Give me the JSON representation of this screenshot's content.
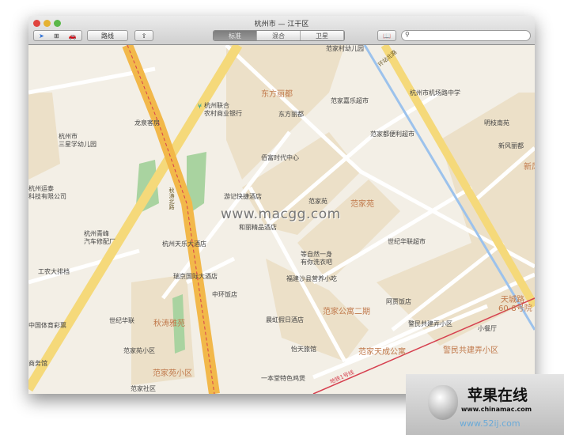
{
  "window": {
    "title": "杭州市 — 江干区"
  },
  "toolbar": {
    "directions_label": "路线",
    "map_types": [
      "标准",
      "混合",
      "卫星"
    ],
    "selected_map_type": "标准",
    "search_placeholder": ""
  },
  "map": {
    "watermark": "www.macgg.com",
    "districts": [
      "东方丽都",
      "范家苑",
      "秋涛雅苑",
      "范家苑小区",
      "范家公寓二期",
      "范家天成公寓",
      "警民共建弄小区",
      "天城路",
      "60-8号院",
      "新风"
    ],
    "pois": [
      "范家村幼儿园",
      "范家嘉乐超市",
      "杭州市机场路中学",
      "东方丽都",
      "范家都便利超市",
      "明枝南苑",
      "新风丽都",
      "佰富时代中心",
      "杭州联合",
      "农村商业银行",
      "龙泉客房",
      "杭州市",
      "三星学幼儿园",
      "杭州运泰",
      "科技有限公司",
      "游记快捷酒店",
      "范家苑",
      "和丽精品酒店",
      "杭州青峰",
      "汽车修配厂",
      "杭州天乐大酒店",
      "工农大排档",
      "瑞京国际大酒店",
      "中环饭店",
      "世纪华联",
      "中国体育彩票",
      "范家苑小区",
      "商务馆",
      "世纪华联超市",
      "等自然一身",
      "有你洗衣吧",
      "福建沙县营养小吃",
      "阿贾饭店",
      "晨虹假日酒店",
      "警民共建弄小区",
      "小餐厅",
      "怡天旅馆",
      "一本堂特色鸡煲",
      "范家社区"
    ],
    "roads": [
      "环站北路",
      "秋涛北路",
      "地铁1号线"
    ]
  },
  "badge": {
    "name": "苹果在线",
    "url1": "www.chinamac.com",
    "url2": "www.52ij.com"
  },
  "colors": {
    "land": "#f3efe6",
    "block": "#ece0c8",
    "major_road": "#f5d97a",
    "express": "#f2b84a",
    "river": "#9cc2ec",
    "metro": "#d6404f",
    "park": "#a9d3a0"
  }
}
